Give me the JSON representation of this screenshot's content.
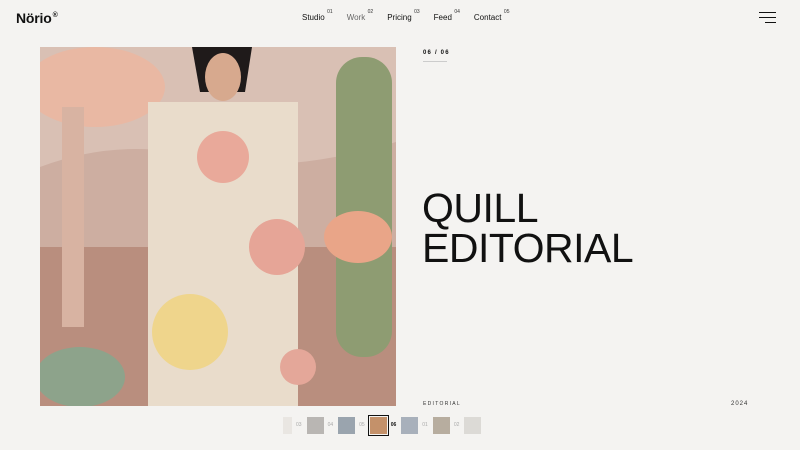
{
  "brand": {
    "name": "Nörio",
    "mark": "®"
  },
  "nav": [
    {
      "label": "Studio",
      "num": "01"
    },
    {
      "label": "Work",
      "num": "02"
    },
    {
      "label": "Pricing",
      "num": "03"
    },
    {
      "label": "Feed",
      "num": "04"
    },
    {
      "label": "Contact",
      "num": "05"
    }
  ],
  "project": {
    "counter": "06 / 06",
    "title_line1": "QUILL",
    "title_line2": "EDITORIAL",
    "category": "EDITORIAL",
    "year": "2024"
  },
  "thumbnails": [
    {
      "num": "03",
      "color": "#e9e6e2"
    },
    {
      "num": "04",
      "color": "#b9b6b3"
    },
    {
      "num": "05",
      "color": "#9aa4ae"
    },
    {
      "num": "06",
      "color": "#c4916a"
    },
    {
      "num": "01",
      "color": "#a8b0bb"
    },
    {
      "num": "02",
      "color": "#b7ad9f"
    },
    {
      "num": "",
      "color": "#dcdad6"
    }
  ],
  "colors": {
    "background": "#f4f3f1",
    "text": "#111111",
    "muted": "#aaaaaa"
  },
  "icons": {
    "menu": "hamburger-icon"
  }
}
